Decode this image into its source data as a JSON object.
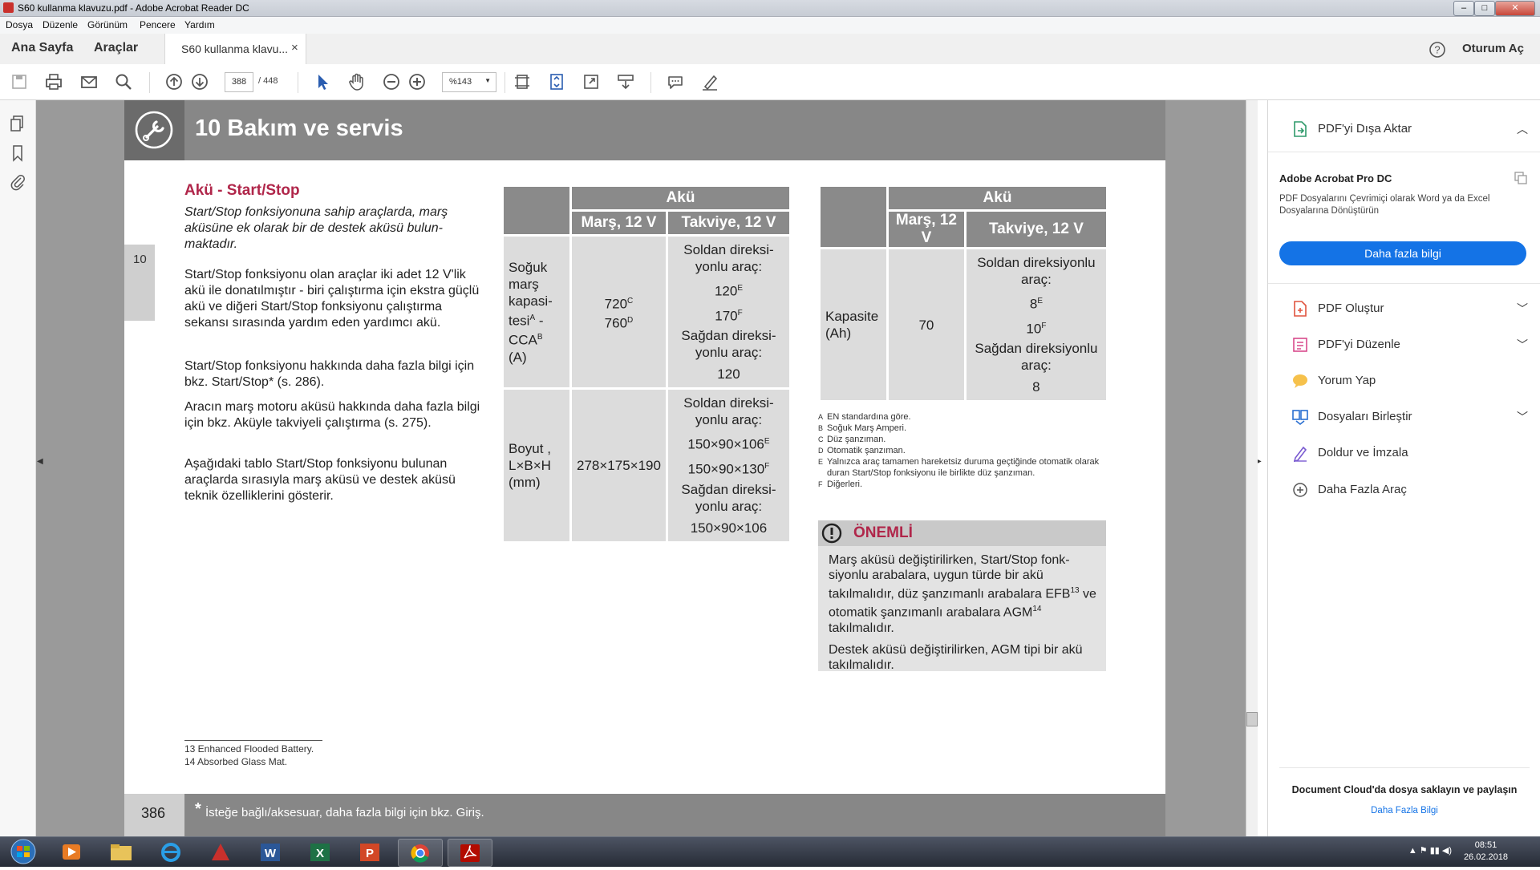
{
  "window": {
    "title": "S60 kullanma klavuzu.pdf - Adobe Acrobat Reader DC"
  },
  "menu": [
    "Dosya",
    "Düzenle",
    "Görünüm",
    "Pencere",
    "Yardım"
  ],
  "tabs": {
    "home": "Ana Sayfa",
    "tools": "Araçlar",
    "document": "S60 kullanma klavu...",
    "close": "×",
    "signin": "Oturum Aç"
  },
  "toolbar": {
    "page_current": "388",
    "page_total": "/ 448",
    "zoom": "%143"
  },
  "doc": {
    "chapter_title": "10 Bakım ve servis",
    "chapter_tab": "10",
    "section_title": "Akü - Start/Stop",
    "intro": "Start/Stop fonksiyonuna sahip araçlarda, marş aküsüne ek olarak bir de destek aküsü bulun­maktadır.",
    "p1": "Start/Stop fonksiyonu olan araçlar iki adet 12 V'lik akü ile donatılmıştır - biri çalıştırma için ekstra güçlü akü ve diğeri Start/Stop fonksi­yonu çalıştırma sekansı sırasında yardım eden yardımcı akü.",
    "p2": "Start/Stop fonksiyonu hakkında daha fazla bilgi için bkz. Start/Stop* (s. 286).",
    "p3": "Aracın marş motoru aküsü hakkında daha fazla bilgi için bkz. Aküyle takviyeli çalıştırma (s. 275).",
    "p4": "Aşağıdaki tablo Start/Stop fonksiyonu bulu­nan araçlarda sırasıyla marş aküsü ve destek aküsü teknik özelliklerini gösterir.",
    "table1": {
      "head_main": "Akü",
      "head_start": "Marş, 12 V",
      "head_boost": "Takviye, 12 V",
      "row1_label": "Soğuk marş kapasi­tesi",
      "row1_label_sup": "A",
      "row1_label_mid": " - CCA",
      "row1_label_sup2": "B",
      "row1_label_unit": "(A)",
      "row1_start_a": "720",
      "row1_start_a_sup": "C",
      "row1_start_b": "760",
      "row1_start_b_sup": "D",
      "left_drive": "Soldan direksi­yonlu araç:",
      "right_drive": "Sağdan direksi­yonlu araç:",
      "row1_boost_a": "120",
      "row1_boost_a_sup": "E",
      "row1_boost_b": "170",
      "row1_boost_b_sup": "F",
      "row1_boost_c": "120",
      "row2_label": "Boyut , L×B×H (mm)",
      "row2_start": "278×175×190",
      "row2_boost_a": "150×90×106",
      "row2_boost_a_sup": "E",
      "row2_boost_b": "150×90×130",
      "row2_boost_b_sup": "F",
      "row2_boost_c": "150×90×106"
    },
    "table2": {
      "head_main": "Akü",
      "head_start": "Marş, 12 V",
      "head_boost": "Takviye, 12 V",
      "row_label": "Kapa­site (Ah)",
      "start": "70",
      "left_drive": "Soldan direksi­yonlu araç:",
      "right_drive": "Sağdan direksi­yonlu araç:",
      "boost_a": "8",
      "boost_a_sup": "E",
      "boost_b": "10",
      "boost_b_sup": "F",
      "boost_c": "8"
    },
    "footnotes": [
      {
        "k": "A",
        "t": "EN standardına göre."
      },
      {
        "k": "B",
        "t": "Soğuk Marş Amperi."
      },
      {
        "k": "C",
        "t": "Düz şanzıman."
      },
      {
        "k": "D",
        "t": "Otomatik şanzıman."
      },
      {
        "k": "E",
        "t": "Yalnızca araç tamamen hareketsiz duruma geçtiğinde oto­matik olarak duran Start/Stop fonksiyonu ile birlikte düz şanzıman."
      },
      {
        "k": "F",
        "t": "Diğerleri."
      }
    ],
    "important": {
      "label": "ÖNEMLİ",
      "p1_a": "Marş aküsü değiştirilirken, Start/Stop fonk­siyonlu arabalara, uygun türde bir akü takılmalıdır, düz şanzımanlı arabalara EFB",
      "p1_sup1": "13",
      "p1_b": " ve otomatik şanzımanlı arabalara AGM",
      "p1_sup2": "14",
      "p1_c": " takılmalıdır.",
      "p2": "Destek aküsü değiştirilirken, AGM tipi bir akü takılmalıdır."
    },
    "bottom_fn1": "13  Enhanced Flooded Battery.",
    "bottom_fn2": "14  Absorbed Glass Mat.",
    "page_number": "386",
    "footer_star": "*",
    "footer_text": "İsteğe bağlı/aksesuar, daha fazla bilgi için bkz. Giriş."
  },
  "right_panel": {
    "export_label": "PDF'yi Dışa Aktar",
    "brand": "Adobe Acrobat Pro DC",
    "desc": "PDF Dosyalarını Çevrimiçi olarak Word ya da Excel Dosyalarına Dönüştürün",
    "button": "Daha fazla bilgi",
    "tools": [
      "PDF Oluştur",
      "PDF'yi Düzenle",
      "Yorum Yap",
      "Dosyaları Birleştir",
      "Doldur ve İmzala",
      "Daha Fazla Araç"
    ],
    "cloud_title": "Document Cloud'da dosya saklayın ve paylaşın",
    "cloud_link": "Daha Fazla Bilgi"
  },
  "taskbar": {
    "time": "08:51",
    "date": "26.02.2018"
  },
  "colors": {
    "accent_red": "#b0264a",
    "acrobat_blue": "#1473e6",
    "chapter_gray": "#878787"
  }
}
